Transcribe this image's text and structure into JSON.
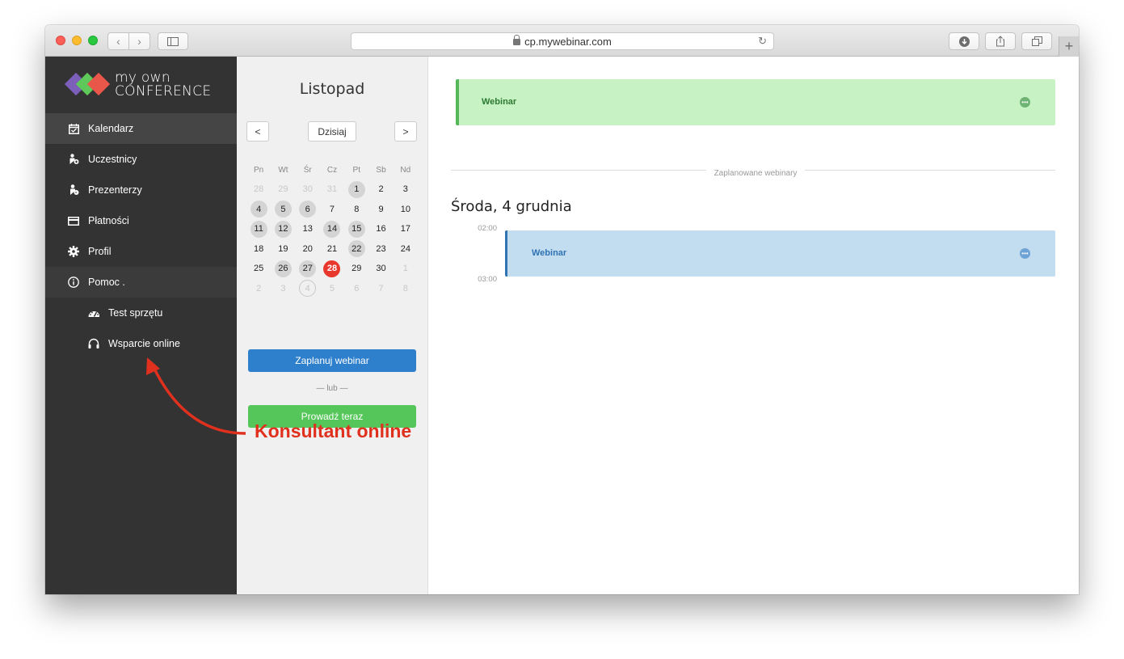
{
  "browser": {
    "url": "cp.mywebinar.com"
  },
  "logo": {
    "line1": "my own",
    "line2": "CONFERENCE",
    "colors": [
      "#7b5fb8",
      "#5fc85a",
      "#e8574a"
    ]
  },
  "sidebar": {
    "items": [
      {
        "label": "Kalendarz",
        "icon": "calendar-check-icon",
        "active": true
      },
      {
        "label": "Uczestnicy",
        "icon": "user-add-icon"
      },
      {
        "label": "Prezenterzy",
        "icon": "presenter-icon"
      },
      {
        "label": "Płatności",
        "icon": "credit-card-icon"
      },
      {
        "label": "Profil",
        "icon": "gear-icon"
      },
      {
        "label": "Pomoc .",
        "icon": "info-icon",
        "open": true
      }
    ],
    "submenu": [
      {
        "label": "Test sprzętu",
        "icon": "speedometer-icon"
      },
      {
        "label": "Wsparcie online",
        "icon": "headset-icon"
      }
    ]
  },
  "calendar": {
    "month": "Listopad",
    "prev": "<",
    "next": ">",
    "today_label": "Dzisiaj",
    "weekdays": [
      "Pn",
      "Wt",
      "Śr",
      "Cz",
      "Pt",
      "Sb",
      "Nd"
    ],
    "weeks": [
      [
        {
          "d": "28",
          "m": 1
        },
        {
          "d": "29",
          "m": 1
        },
        {
          "d": "30",
          "m": 1
        },
        {
          "d": "31",
          "m": 1
        },
        {
          "d": "1",
          "e": 1
        },
        {
          "d": "2"
        },
        {
          "d": "3"
        }
      ],
      [
        {
          "d": "4",
          "e": 1
        },
        {
          "d": "5",
          "e": 1
        },
        {
          "d": "6",
          "e": 1
        },
        {
          "d": "7"
        },
        {
          "d": "8"
        },
        {
          "d": "9"
        },
        {
          "d": "10"
        }
      ],
      [
        {
          "d": "11",
          "e": 1
        },
        {
          "d": "12",
          "e": 1
        },
        {
          "d": "13"
        },
        {
          "d": "14",
          "e": 1
        },
        {
          "d": "15",
          "e": 1
        },
        {
          "d": "16"
        },
        {
          "d": "17"
        }
      ],
      [
        {
          "d": "18"
        },
        {
          "d": "19"
        },
        {
          "d": "20"
        },
        {
          "d": "21"
        },
        {
          "d": "22",
          "e": 1
        },
        {
          "d": "23"
        },
        {
          "d": "24"
        }
      ],
      [
        {
          "d": "25"
        },
        {
          "d": "26",
          "e": 1
        },
        {
          "d": "27",
          "e": 1
        },
        {
          "d": "28",
          "t": 1
        },
        {
          "d": "29"
        },
        {
          "d": "30"
        },
        {
          "d": "1",
          "m": 1
        }
      ],
      [
        {
          "d": "2",
          "m": 1
        },
        {
          "d": "3",
          "m": 1
        },
        {
          "d": "4",
          "m": 1,
          "r": 1
        },
        {
          "d": "5",
          "m": 1
        },
        {
          "d": "6",
          "m": 1
        },
        {
          "d": "7",
          "m": 1
        },
        {
          "d": "8",
          "m": 1
        }
      ]
    ],
    "schedule_label": "Zaplanuj webinar",
    "or_label": "— lub —",
    "live_label": "Prowadź teraz"
  },
  "main": {
    "live_event": {
      "label": "Webinar",
      "color": "#c6f2c4"
    },
    "divider_label": "Zaplanowane webinary",
    "day_title": "Środa, 4 grudnia",
    "times": [
      "02:00",
      "03:00"
    ],
    "scheduled_event": {
      "label": "Webinar",
      "color": "#c2dcf0"
    }
  },
  "annotation": {
    "text": "Konsultant online",
    "color": "#e0301e"
  }
}
